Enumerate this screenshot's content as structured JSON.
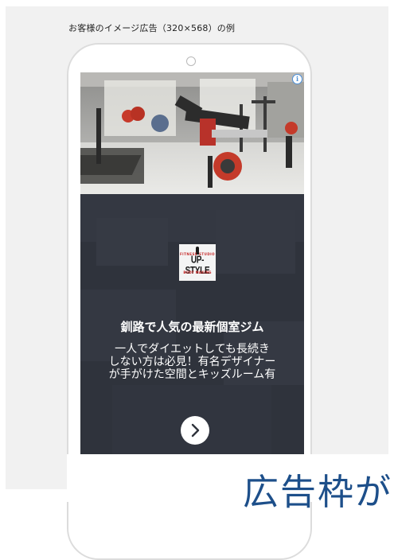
{
  "page": {
    "caption": "お客様のイメージ広告（320×568）の例"
  },
  "ad": {
    "info_glyph": "i",
    "logo": {
      "top_text": "FITNESS STUDIO",
      "main_text": "UP-STYLE",
      "sub_text": "BODY MAKING"
    },
    "headline": "釧路で人気の最新個室ジム",
    "body_lines": [
      "一人でダイエットしても長続き",
      "しない方は必見！有名デザイナー",
      "が手がけた空間とキッズルーム有"
    ],
    "cta_icon": "chevron-right-icon"
  },
  "overlay": {
    "text": "広告枠が"
  },
  "colors": {
    "panel_bg": "#f1f1f1",
    "ad_bg": "#2f333c",
    "overlay_text": "#1d4f8a",
    "info_icon": "#4a8fd8"
  }
}
